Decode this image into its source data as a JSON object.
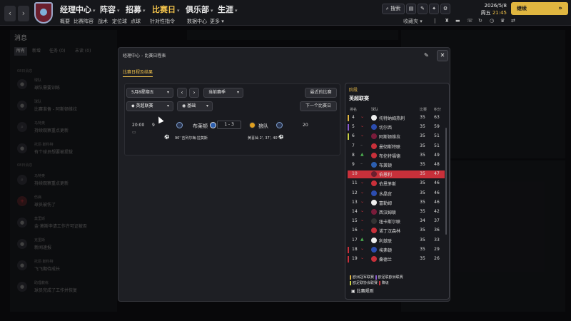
{
  "topbar": {
    "menus": [
      "经理中心",
      "阵容",
      "招募",
      "比赛日",
      "俱乐部",
      "生涯"
    ],
    "submenu": [
      "概要",
      "比赛阵容",
      "战术",
      "定位球",
      "点球",
      "针对性指令",
      "数据中心",
      "更多"
    ],
    "search_label": "搜索",
    "date": "2026/5/8",
    "weekday": "周五",
    "time": "21:45",
    "continue_label": "继续",
    "inbox_label": "收藏夹"
  },
  "messages": {
    "title": "消息",
    "tabs": [
      "所有",
      "新增",
      "任务 (0)",
      "未读 (0)"
    ],
    "section1": "08日消息",
    "section2": "08日消息",
    "items": [
      {
        "from": "球队",
        "text": "球队需要训练"
      },
      {
        "from": "球队",
        "text": "比赛准备 - 阿斯顿维拉"
      },
      {
        "from": "马特奥",
        "text": "持续观察重点更新"
      },
      {
        "from": "托尼·斯科特",
        "text": "有个球员想要被提拔"
      },
      {
        "from": "马特奥",
        "text": "持续观察重点更新"
      },
      {
        "from": "伤病",
        "text": "球员被伤了"
      },
      {
        "from": "莫里斯",
        "text": "金·莫斯申请工作许可证被否"
      },
      {
        "from": "克里斯",
        "text": "新闻速报"
      },
      {
        "from": "托尼·斯科特",
        "text": "飞飞期待成长"
      },
      {
        "from": "助理教练",
        "text": "球员完成了工作并恢复"
      }
    ]
  },
  "modal": {
    "breadcrumb": [
      "经理中心",
      "比赛日程表"
    ],
    "subtab": "比赛日程及结果",
    "date_select": "5月8星期五",
    "season_select": "当前赛季",
    "recent_label": "最近的比赛",
    "comp_select": "英超联赛",
    "view_select": "基础",
    "next_label": "下一个比赛日",
    "match": {
      "time": "20:00",
      "round": "9",
      "home": "布莱顿",
      "score": "1 - 3",
      "away": "狼队",
      "attendance": "20",
      "home_scorers": "90' 吉列尔梅·拉莫斯",
      "away_scorers": "黄喜灿 2', 37', 40'"
    }
  },
  "table": {
    "stage": "阶段",
    "title": "英超联赛",
    "headers": [
      "排名",
      "球队",
      "比赛",
      "积分"
    ],
    "rows": [
      {
        "pos": "4",
        "name": "托特纳姆热刺",
        "pl": "35",
        "pts": "63",
        "zone": "#e0b640",
        "crest": "#eeeeee"
      },
      {
        "pos": "5",
        "name": "切尔西",
        "pl": "35",
        "pts": "59",
        "zone": "#8a5bd1",
        "crest": "#2c4db0"
      },
      {
        "pos": "6",
        "name": "阿斯顿维拉",
        "pl": "35",
        "pts": "51",
        "zone": "#c8d145",
        "crest": "#7a1c3a"
      },
      {
        "pos": "7",
        "name": "曼彻斯特联",
        "pl": "35",
        "pts": "51",
        "zone": "",
        "crest": "#c8303a"
      },
      {
        "pos": "8",
        "name": "布伦特福德",
        "pl": "35",
        "pts": "49",
        "zone": "",
        "crest": "#c8303a"
      },
      {
        "pos": "9",
        "name": "布莱顿",
        "pl": "35",
        "pts": "48",
        "zone": "",
        "crest": "#2c5fb0"
      },
      {
        "pos": "10",
        "name": "伯恩利",
        "pl": "35",
        "pts": "47",
        "zone": "",
        "crest": "#6b1f2e"
      },
      {
        "pos": "11",
        "name": "伯恩茅斯",
        "pl": "35",
        "pts": "46",
        "zone": "",
        "crest": "#c8303a"
      },
      {
        "pos": "12",
        "name": "水晶宫",
        "pl": "35",
        "pts": "46",
        "zone": "",
        "crest": "#2c4db0"
      },
      {
        "pos": "13",
        "name": "富勒姆",
        "pl": "35",
        "pts": "46",
        "zone": "",
        "crest": "#eeeeee"
      },
      {
        "pos": "14",
        "name": "西汉姆联",
        "pl": "35",
        "pts": "42",
        "zone": "",
        "crest": "#7a1c3a"
      },
      {
        "pos": "15",
        "name": "纽卡斯尔联",
        "pl": "34",
        "pts": "37",
        "zone": "",
        "crest": "#333333"
      },
      {
        "pos": "16",
        "name": "诺丁汉森林",
        "pl": "35",
        "pts": "36",
        "zone": "",
        "crest": "#c8303a"
      },
      {
        "pos": "17",
        "name": "利兹联",
        "pl": "35",
        "pts": "33",
        "zone": "",
        "crest": "#eeeeee"
      },
      {
        "pos": "18",
        "name": "埃弗顿",
        "pl": "35",
        "pts": "29",
        "zone": "#c8303a",
        "crest": "#2c4db0"
      },
      {
        "pos": "19",
        "name": "桑德兰",
        "pl": "35",
        "pts": "26",
        "zone": "#c8303a",
        "crest": "#c8303a"
      }
    ],
    "mv_up": [
      8,
      17
    ],
    "legend": [
      "欧洲冠军联赛",
      "欧足联欧洲联赛",
      "欧足联协会联赛",
      "降级"
    ],
    "rules_label": "比赛规则"
  }
}
